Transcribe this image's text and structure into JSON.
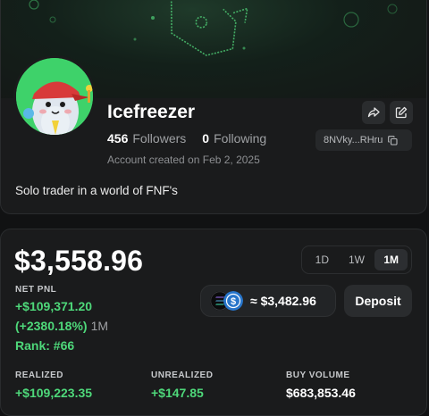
{
  "profile": {
    "username": "Icefreezer",
    "followers_count": "456",
    "followers_label": "Followers",
    "following_count": "0",
    "following_label": "Following",
    "account_created": "Account created on Feb 2, 2025",
    "wallet_address": "8NVky...RHru",
    "bio": "Solo trader in a world of FNF's",
    "share_icon": "share-icon",
    "edit_icon": "edit-icon",
    "copy_icon": "copy-icon"
  },
  "pnl": {
    "total_value": "$3,558.96",
    "time_ranges": [
      "1D",
      "1W",
      "1M"
    ],
    "selected_range": "1M",
    "net_pnl_label": "NET PNL",
    "net_pnl_value": "+$109,371.20",
    "net_pnl_percent": "(+2380.18%)",
    "net_pnl_period": "1M",
    "rank": "Rank: #66",
    "balance": "≈ $3,482.96",
    "deposit_label": "Deposit",
    "realized_label": "REALIZED",
    "realized_value": "+$109,223.35",
    "unrealized_label": "UNREALIZED",
    "unrealized_value": "+$147.85",
    "buy_volume_label": "BUY VOLUME",
    "buy_volume_value": "$683,853.46"
  },
  "colors": {
    "positive": "#4ed87a",
    "background": "#111213",
    "card": "#1a1b1c",
    "avatar_bg": "#3ed26a"
  }
}
